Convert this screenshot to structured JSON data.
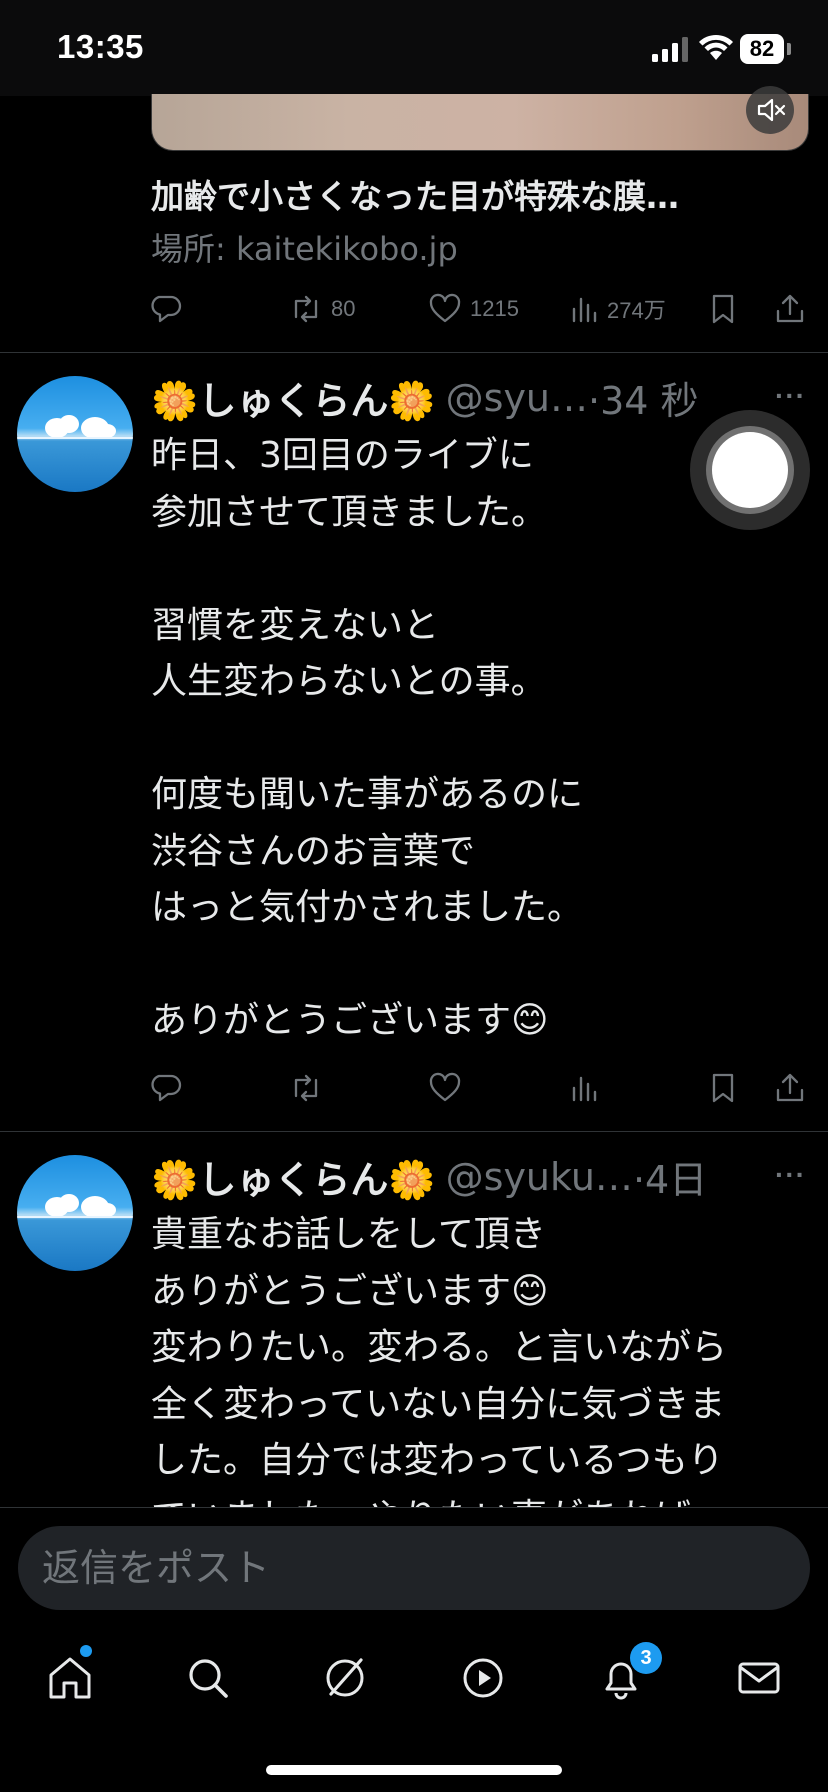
{
  "status_bar": {
    "time": "13:35",
    "battery": "82"
  },
  "link_card": {
    "title": "加齢で小さくなった目が特殊な膜…",
    "domain": "場所: kaitekikobo.jp",
    "retweets": "80",
    "likes": "1215",
    "views": "274万"
  },
  "posts": [
    {
      "name": "🌼しゅくらん🌼",
      "handle": "@syu…",
      "time": "·34 秒",
      "lines": [
        "昨日、3回目のライブに",
        "参加させて頂きました。",
        "",
        "習慣を変えないと",
        "人生変わらないとの事。",
        "",
        "何度も聞いた事があるのに",
        "渋谷さんのお言葉で",
        "はっと気付かされました。",
        "",
        "ありがとうございます😊"
      ]
    },
    {
      "name": "🌼しゅくらん🌼",
      "handle": "@syuku…",
      "time": "·4日",
      "lines": [
        "貴重なお話しをして頂き",
        "ありがとうございます😊",
        "変わりたい。変わる。と言いながら",
        "全く変わっていない自分に気づきま",
        "した。自分では変わっているつもり",
        "でいました。やりたい事があれば"
      ]
    }
  ],
  "reply": {
    "placeholder": "返信をポスト"
  },
  "tabs": {
    "notifications_badge": "3"
  },
  "colors": {
    "accent": "#1d9bf0",
    "muted": "#71767b",
    "text": "#e7e9ea",
    "background": "#000000"
  }
}
